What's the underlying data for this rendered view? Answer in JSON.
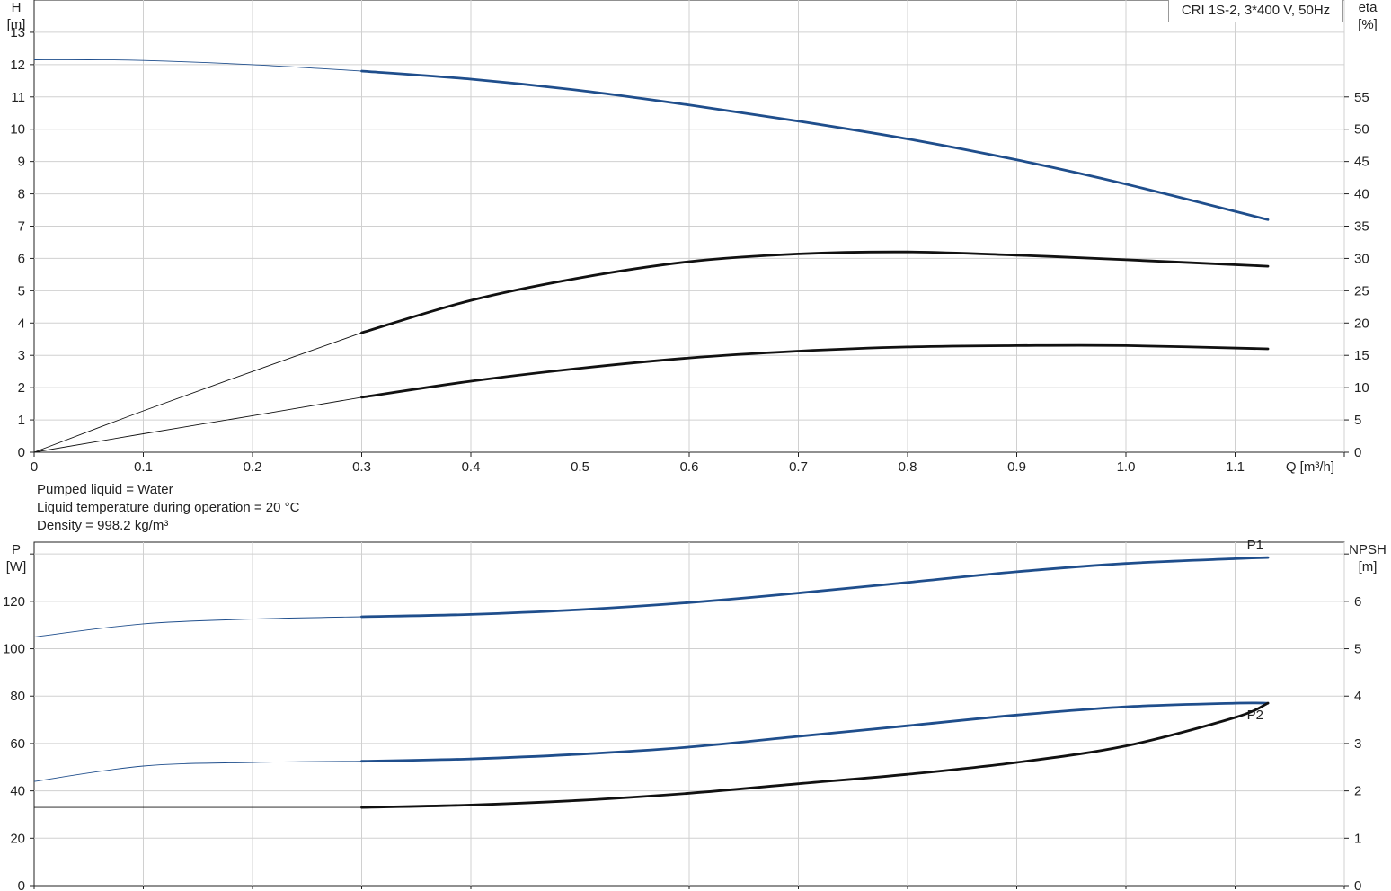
{
  "chart_data": [
    {
      "type": "line",
      "title": "CRI 1S-2, 3*400 V, 50Hz",
      "xlabel": "Q [m³/h]",
      "x_ticks": [
        "0",
        "0.1",
        "0.2",
        "0.3",
        "0.4",
        "0.5",
        "0.6",
        "0.7",
        "0.8",
        "0.9",
        "1.0",
        "1.1"
      ],
      "xlim": [
        0,
        1.2
      ],
      "y_left": {
        "label_top": "H",
        "label_unit": "[m]",
        "lim": [
          0,
          14
        ],
        "ticks": [
          "0",
          "1",
          "2",
          "3",
          "4",
          "5",
          "6",
          "7",
          "8",
          "9",
          "10",
          "11",
          "12",
          "13"
        ]
      },
      "y_right": {
        "label_top": "eta",
        "label_unit": "[%]",
        "lim": [
          0,
          70
        ],
        "ticks": [
          "0",
          "5",
          "10",
          "15",
          "20",
          "25",
          "30",
          "35",
          "40",
          "45",
          "50",
          "55"
        ]
      },
      "grid": true,
      "series": [
        {
          "axis": "left",
          "color": "#1f4e8c",
          "operating_from": 0.3,
          "x": [
            0,
            0.05,
            0.1,
            0.2,
            0.3,
            0.4,
            0.5,
            0.6,
            0.7,
            0.8,
            0.9,
            1.0,
            1.13
          ],
          "y": [
            12.15,
            12.15,
            12.13,
            12.0,
            11.8,
            11.55,
            11.2,
            10.75,
            10.25,
            9.7,
            9.05,
            8.3,
            7.2
          ]
        },
        {
          "axis": "right",
          "color": "#111111",
          "operating_from": 0.3,
          "x": [
            0,
            0.1,
            0.2,
            0.3,
            0.4,
            0.5,
            0.6,
            0.7,
            0.8,
            0.9,
            1.0,
            1.13
          ],
          "y": [
            0,
            6.4,
            12.5,
            18.5,
            23.5,
            27.0,
            29.5,
            30.7,
            31.0,
            30.5,
            29.8,
            28.8
          ]
        },
        {
          "axis": "left",
          "color": "#111111",
          "operating_from": 0.3,
          "x": [
            0,
            0.1,
            0.2,
            0.3,
            0.4,
            0.5,
            0.6,
            0.7,
            0.8,
            0.9,
            1.0,
            1.13
          ],
          "y": [
            0,
            0.57,
            1.13,
            1.7,
            2.2,
            2.6,
            2.92,
            3.13,
            3.26,
            3.3,
            3.3,
            3.2
          ]
        }
      ]
    },
    {
      "type": "line",
      "xlim": [
        0,
        1.2
      ],
      "y_left": {
        "label_top": "P",
        "label_unit": "[W]",
        "lim": [
          0,
          145
        ],
        "ticks": [
          "0",
          "20",
          "40",
          "60",
          "80",
          "100",
          "120"
        ]
      },
      "y_right": {
        "label_top": "NPSH",
        "label_unit": "[m]",
        "lim": [
          0,
          7.25
        ],
        "ticks": [
          "0",
          "1",
          "2",
          "3",
          "4",
          "5",
          "6"
        ]
      },
      "grid": true,
      "series": [
        {
          "name": "P1",
          "axis": "left",
          "color": "#1f4e8c",
          "operating_from": 0.3,
          "x": [
            0,
            0.1,
            0.2,
            0.3,
            0.4,
            0.5,
            0.6,
            0.7,
            0.8,
            0.9,
            1.0,
            1.1,
            1.13
          ],
          "y": [
            105,
            110.5,
            112.5,
            113.5,
            114.5,
            116.5,
            119.5,
            123.5,
            128.0,
            132.5,
            136.0,
            138.0,
            138.5
          ]
        },
        {
          "name": "P2",
          "axis": "left",
          "color": "#1f4e8c",
          "operating_from": 0.3,
          "x": [
            0,
            0.1,
            0.2,
            0.3,
            0.4,
            0.5,
            0.6,
            0.7,
            0.8,
            0.9,
            1.0,
            1.1,
            1.13
          ],
          "y": [
            44,
            50.5,
            52.0,
            52.5,
            53.5,
            55.5,
            58.5,
            63.0,
            67.5,
            72.0,
            75.5,
            77.0,
            77.0
          ]
        },
        {
          "axis": "right",
          "color": "#111111",
          "operating_from": 0.3,
          "x": [
            0,
            0.3,
            0.4,
            0.5,
            0.6,
            0.7,
            0.8,
            0.9,
            1.0,
            1.1,
            1.13
          ],
          "y": [
            1.65,
            1.65,
            1.7,
            1.8,
            1.95,
            2.15,
            2.35,
            2.6,
            2.95,
            3.55,
            3.85
          ]
        }
      ]
    }
  ],
  "notes": [
    "Pumped liquid = Water",
    "Liquid temperature during operation = 20 °C",
    "Density = 998.2 kg/m³"
  ]
}
